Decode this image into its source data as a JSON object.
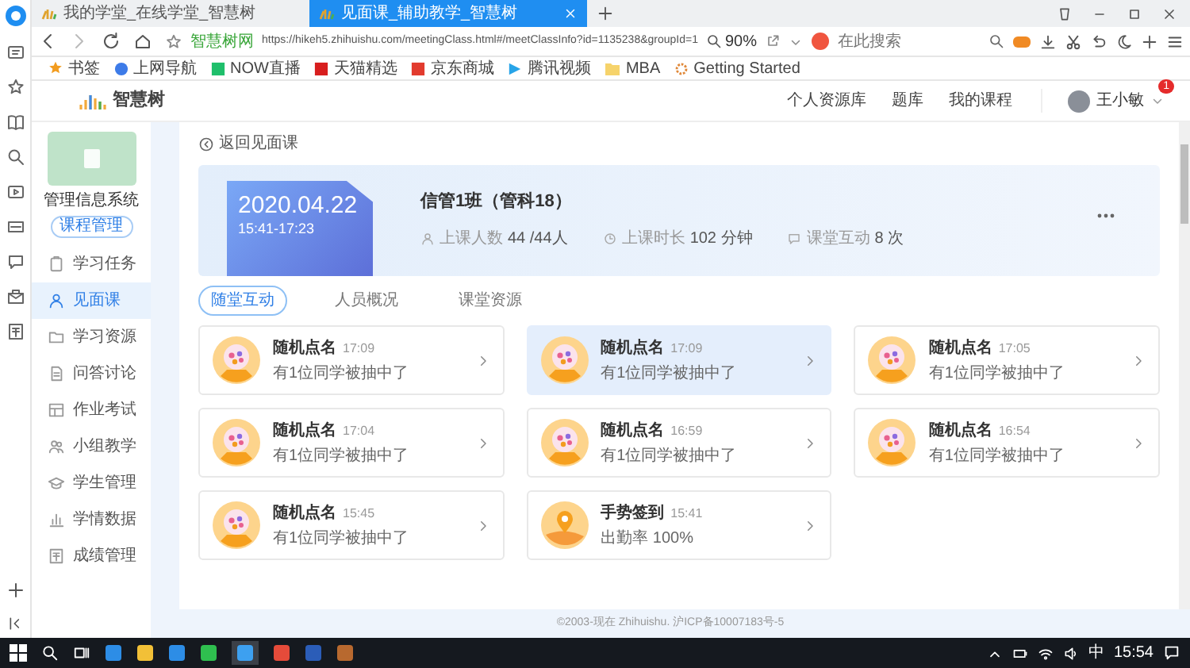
{
  "browser": {
    "tabs": [
      {
        "label": "我的学堂_在线学堂_智慧树",
        "selected": false
      },
      {
        "label": "见面课_辅助教学_智慧树",
        "selected": true
      }
    ],
    "address_bar": {
      "site_label": "智慧树网",
      "url": "https://hikeh5.zhihuishu.com/meetingClass.html#/meetClassInfo?id=1135238&groupId=1",
      "zoom": "90%",
      "search_placeholder": "在此搜索"
    },
    "bookmarks": [
      "书签",
      "上网导航",
      "NOW直播",
      "天猫精选",
      "京东商城",
      "腾讯视频",
      "MBA",
      "Getting Started"
    ]
  },
  "site_header": {
    "logo_text": "智慧树",
    "nav": [
      "个人资源库",
      "题库",
      "我的课程"
    ],
    "user_name": "王小敏",
    "notification_count": "1"
  },
  "sidebar": {
    "course_name": "管理信息系统",
    "course_button": "课程管理",
    "items": [
      {
        "label": "学习任务",
        "selected": false
      },
      {
        "label": "见面课",
        "selected": true
      },
      {
        "label": "学习资源",
        "selected": false
      },
      {
        "label": "问答讨论",
        "selected": false
      },
      {
        "label": "作业考试",
        "selected": false
      },
      {
        "label": "小组教学",
        "selected": false
      },
      {
        "label": "学生管理",
        "selected": false
      },
      {
        "label": "学情数据",
        "selected": false
      },
      {
        "label": "成绩管理",
        "selected": false
      }
    ]
  },
  "main": {
    "back_link": "返回见面课",
    "session": {
      "date": "2020.04.22",
      "time": "15:41-17:23",
      "title": "信管1班（管科18）",
      "stats": [
        {
          "label": "上课人数",
          "value": "44 /44人"
        },
        {
          "label": "上课时长",
          "value": "102 分钟"
        },
        {
          "label": "课堂互动",
          "value": "8 次"
        }
      ]
    },
    "tabs": [
      {
        "label": "随堂互动",
        "selected": true
      },
      {
        "label": "人员概况",
        "selected": false
      },
      {
        "label": "课堂资源",
        "selected": false
      }
    ],
    "activities": [
      {
        "kind": "roll_call",
        "title": "随机点名",
        "time": "17:09",
        "detail": "有1位同学被抽中了",
        "highlighted": false
      },
      {
        "kind": "roll_call",
        "title": "随机点名",
        "time": "17:09",
        "detail": "有1位同学被抽中了",
        "highlighted": true
      },
      {
        "kind": "roll_call",
        "title": "随机点名",
        "time": "17:05",
        "detail": "有1位同学被抽中了",
        "highlighted": false
      },
      {
        "kind": "roll_call",
        "title": "随机点名",
        "time": "17:04",
        "detail": "有1位同学被抽中了",
        "highlighted": false
      },
      {
        "kind": "roll_call",
        "title": "随机点名",
        "time": "16:59",
        "detail": "有1位同学被抽中了",
        "highlighted": false
      },
      {
        "kind": "roll_call",
        "title": "随机点名",
        "time": "16:54",
        "detail": "有1位同学被抽中了",
        "highlighted": false
      },
      {
        "kind": "roll_call",
        "title": "随机点名",
        "time": "15:45",
        "detail": "有1位同学被抽中了",
        "highlighted": false
      },
      {
        "kind": "check_in",
        "title": "手势签到",
        "time": "15:41",
        "detail": "出勤率 100%",
        "highlighted": false
      }
    ],
    "footer": "©2003-现在 Zhihuishu. 沪ICP备10007183号-5"
  },
  "taskbar": {
    "input_method": "中",
    "clock": "15:54"
  }
}
